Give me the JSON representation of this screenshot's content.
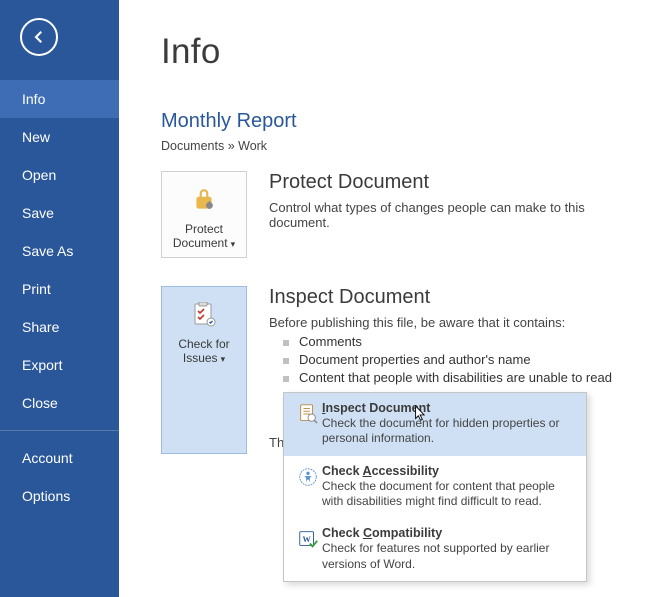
{
  "sidebar": {
    "items": [
      {
        "label": "Info"
      },
      {
        "label": "New"
      },
      {
        "label": "Open"
      },
      {
        "label": "Save"
      },
      {
        "label": "Save As"
      },
      {
        "label": "Print"
      },
      {
        "label": "Share"
      },
      {
        "label": "Export"
      },
      {
        "label": "Close"
      }
    ],
    "footer": [
      {
        "label": "Account"
      },
      {
        "label": "Options"
      }
    ]
  },
  "page": {
    "title": "Info",
    "docTitle": "Monthly Report",
    "breadcrumb": "Documents » Work"
  },
  "protect": {
    "tileLine1": "Protect",
    "tileLine2": "Document",
    "heading": "Protect Document",
    "desc": "Control what types of changes people can make to this document."
  },
  "inspect": {
    "tileLine1": "Check for",
    "tileLine2": "Issues",
    "heading": "Inspect Document",
    "desc": "Before publishing this file, be aware that it contains:",
    "bullets": [
      "Comments",
      "Document properties and author's name",
      "Content that people with disabilities are unable to read"
    ],
    "unsavedLabel": "There are no unsaved changes."
  },
  "dropdown": [
    {
      "title": "Inspect Document",
      "underlineIndex": 0,
      "desc": "Check the document for hidden properties or personal information."
    },
    {
      "title": "Check Accessibility",
      "underlineIndex": 6,
      "desc": "Check the document for content that people with disabilities might find difficult to read."
    },
    {
      "title": "Check Compatibility",
      "underlineIndex": 6,
      "desc": "Check for features not supported by earlier versions of Word."
    }
  ]
}
